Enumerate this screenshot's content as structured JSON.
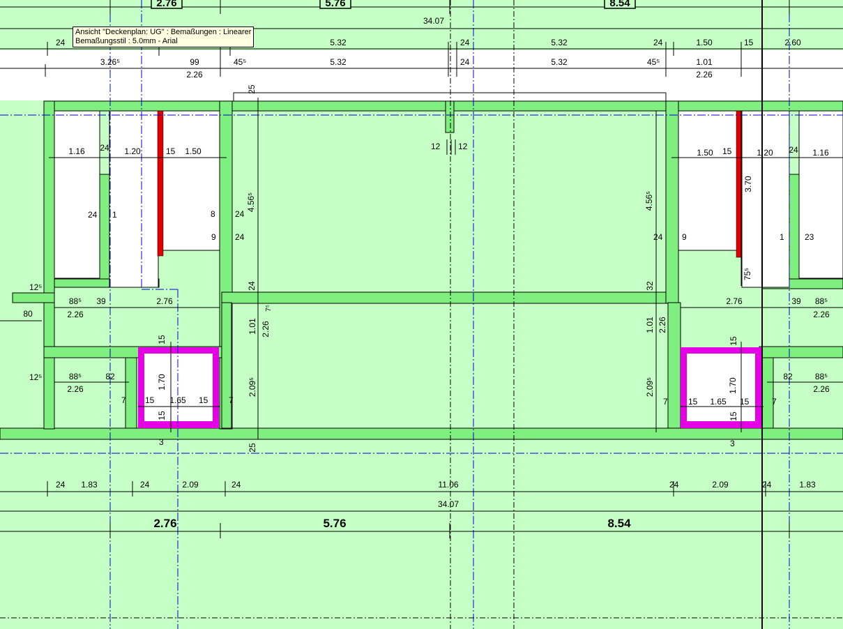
{
  "tooltip": {
    "line1": "Ansicht \"Deckenplan: UG\" : Bemaßungen : Linearer",
    "line2": "Bemaßungsstil : 5.0mm - Arial"
  },
  "colors": {
    "background": "#c6ffc6",
    "wall_fill": "#7fef7f",
    "room_white": "#ffffff",
    "grid_line": "#0000cc",
    "highlight_red": "#e00000",
    "highlight_magenta": "#e600e6",
    "tooltip_bg": "#ffffe1"
  },
  "top_tags": [
    "2.76",
    "5.76",
    "8.54"
  ],
  "dims": {
    "total_top": "34.07",
    "r1": [
      "24",
      "5.32",
      "24",
      "5.32",
      "24",
      "1.50",
      "15",
      "2.60"
    ],
    "r2": [
      "3.26⁵",
      "99",
      "2.26",
      "45⁵",
      "5.32",
      "24",
      "5.32",
      "45⁵",
      "1.01",
      "2.26"
    ],
    "left_room": [
      "1.16",
      "24",
      "1.20",
      "15",
      "1.50",
      "24",
      "1",
      "8",
      "24",
      "9",
      "24"
    ],
    "center": [
      "25",
      "12",
      "12",
      "4.56⁵",
      "4.56⁵",
      "24",
      "32",
      "7⁵",
      "1.01",
      "2.26",
      "1.01",
      "2.26",
      "2.09⁵",
      "2.09⁵",
      "25"
    ],
    "right_room": [
      "1.50",
      "15",
      "1.20",
      "24",
      "1.16",
      "3.70",
      "1",
      "23",
      "24",
      "9",
      "75⁵"
    ],
    "left_lower": [
      "12⁵",
      "88⁵",
      "39",
      "2.76",
      "80",
      "2.26",
      "12⁵",
      "88⁵",
      "82",
      "2.26"
    ],
    "right_lower": [
      "2.76",
      "39",
      "88⁵",
      "2.26",
      "82",
      "88⁵",
      "2.26"
    ],
    "shaft_left": [
      "15",
      "1.70",
      "7",
      "15",
      "1.65",
      "15",
      "7",
      "15",
      "3"
    ],
    "shaft_right": [
      "15",
      "1.70",
      "7",
      "15",
      "1.65",
      "15",
      "7",
      "15",
      "3"
    ],
    "bottom_r1": [
      "24",
      "1.83",
      "24",
      "2.09",
      "24",
      "11.06",
      "24",
      "2.09",
      "24",
      "1.83"
    ],
    "total_bottom": "34.07",
    "bottom_big": [
      "2.76",
      "5.76",
      "8.54"
    ]
  }
}
